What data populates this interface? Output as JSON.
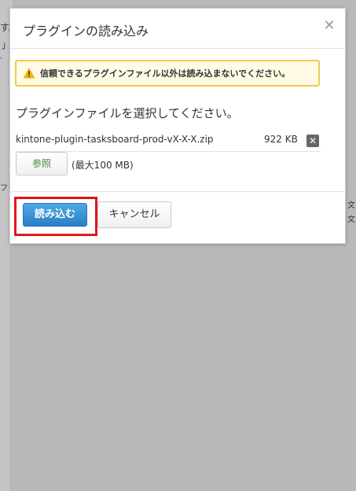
{
  "background": {
    "fragments": [
      "す。",
      "」",
      "゙",
      "ファ",
      "文",
      "文"
    ]
  },
  "dialog": {
    "title": "プラグインの読み込み",
    "close_icon": "close-icon",
    "warning": {
      "icon": "warning-icon",
      "text": "信頼できるプラグインファイル以外は読み込まないでください。",
      "border_color": "#f2c94c",
      "background_color": "#fffbe5"
    },
    "instruction": "プラグインファイルを選択してください。",
    "file": {
      "name": "kintone-plugin-tasksboard-prod-vX-X-X.zip",
      "size": "922 KB",
      "remove_icon": "remove-icon"
    },
    "browse_label": "参照",
    "size_limit": "(最大100 MB)",
    "load_label": "読み込む",
    "cancel_label": "キャンセル",
    "load_color": "#2b7fc5",
    "highlight_color": "#e0161c"
  }
}
